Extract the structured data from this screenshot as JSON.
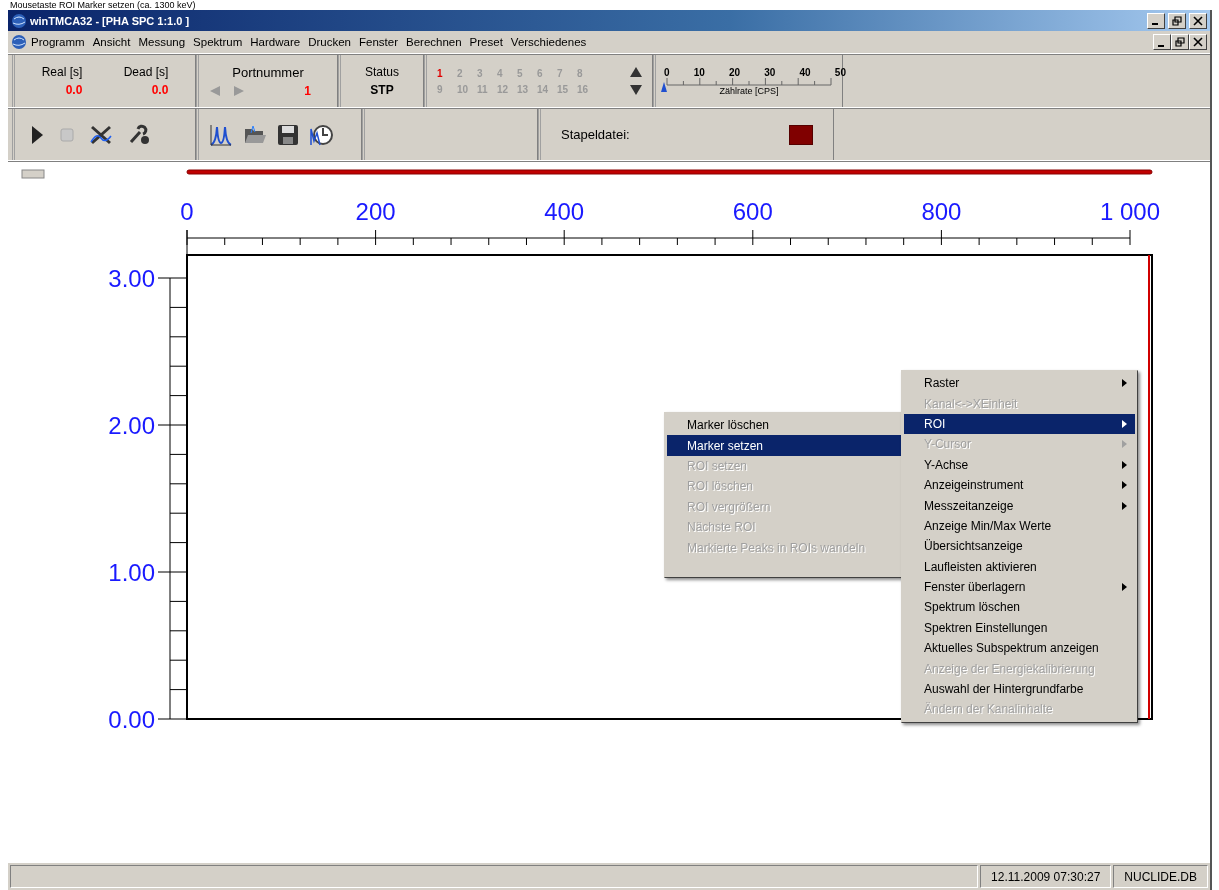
{
  "caption": "Mousetaste ROI Marker setzen (ca. 1300 keV)",
  "window": {
    "title": "winTMCA32 - [PHA SPC 1:1.0  ]"
  },
  "menu_bar": [
    "Programm",
    "Ansicht",
    "Messung",
    "Spektrum",
    "Hardware",
    "Drucken",
    "Fenster",
    "Berechnen",
    "Preset",
    "Verschiedenes"
  ],
  "times": [
    {
      "label": "Real [s]",
      "value": "0.0"
    },
    {
      "label": "Dead [s]",
      "value": "0.0"
    }
  ],
  "port": {
    "label": "Portnummer",
    "value": "1"
  },
  "status": {
    "label": "Status",
    "value": "STP"
  },
  "channels": [
    {
      "label": "1",
      "selected": true
    },
    {
      "label": "2",
      "selected": false
    },
    {
      "label": "3",
      "selected": false
    },
    {
      "label": "4",
      "selected": false
    },
    {
      "label": "5",
      "selected": false
    },
    {
      "label": "6",
      "selected": false
    },
    {
      "label": "7",
      "selected": false
    },
    {
      "label": "8",
      "selected": false
    },
    {
      "label": "9",
      "selected": false
    },
    {
      "label": "10",
      "selected": false
    },
    {
      "label": "11",
      "selected": false
    },
    {
      "label": "12",
      "selected": false
    },
    {
      "label": "13",
      "selected": false
    },
    {
      "label": "14",
      "selected": false
    },
    {
      "label": "15",
      "selected": false
    },
    {
      "label": "16",
      "selected": false
    }
  ],
  "rate_meter": {
    "ticks": [
      "0",
      "10",
      "20",
      "30",
      "40",
      "50"
    ],
    "label": "Zählrate [CPS]"
  },
  "batch": {
    "label": "Stapeldatei:"
  },
  "chart_data": {
    "type": "line",
    "xlim": [
      0,
      1000
    ],
    "ylim": [
      0,
      3
    ],
    "xticks": [
      0,
      200,
      400,
      600,
      800,
      {
        "value": 1000,
        "label": "1 000"
      }
    ],
    "yticks": [
      {
        "value": 0,
        "label": "0.00"
      },
      {
        "value": 1,
        "label": "1.00"
      },
      {
        "value": 2,
        "label": "2.00"
      },
      {
        "value": 3,
        "label": "3.00"
      }
    ]
  },
  "context_menu": [
    {
      "label": "Raster",
      "disabled": false,
      "selected": false,
      "submenu": true
    },
    {
      "label": "Kanal<->XEinheit",
      "disabled": true,
      "selected": false,
      "submenu": false
    },
    {
      "label": "ROI",
      "disabled": false,
      "selected": true,
      "submenu": true
    },
    {
      "label": "Y-Cursor",
      "disabled": true,
      "selected": false,
      "submenu": true
    },
    {
      "label": "Y-Achse",
      "disabled": false,
      "selected": false,
      "submenu": true
    },
    {
      "label": "Anzeigeinstrument",
      "disabled": false,
      "selected": false,
      "submenu": true
    },
    {
      "label": "Messzeitanzeige",
      "disabled": false,
      "selected": false,
      "submenu": true
    },
    {
      "label": "Anzeige Min/Max Werte",
      "disabled": false,
      "selected": false,
      "submenu": false
    },
    {
      "label": "Übersichtsanzeige",
      "disabled": false,
      "selected": false,
      "submenu": false
    },
    {
      "label": "Laufleisten aktivieren",
      "disabled": false,
      "selected": false,
      "submenu": false
    },
    {
      "label": "Fenster überlagern",
      "disabled": false,
      "selected": false,
      "submenu": true
    },
    {
      "label": "Spektrum löschen",
      "disabled": false,
      "selected": false,
      "submenu": false
    },
    {
      "label": "Spektren Einstellungen",
      "disabled": false,
      "selected": false,
      "submenu": false
    },
    {
      "label": "Aktuelles Subspektrum anzeigen",
      "disabled": false,
      "selected": false,
      "submenu": false
    },
    {
      "label": "Anzeige der Energiekalibrierung",
      "disabled": true,
      "selected": false,
      "submenu": false
    },
    {
      "label": "Auswahl der Hintergrundfarbe",
      "disabled": false,
      "selected": false,
      "submenu": false
    },
    {
      "label": "Ändern der Kanalinhalte",
      "disabled": true,
      "selected": false,
      "submenu": false
    }
  ],
  "submenu": [
    {
      "label": "Marker löschen",
      "disabled": false,
      "selected": false
    },
    {
      "label": "Marker setzen",
      "disabled": false,
      "selected": true
    },
    {
      "label": "ROI setzen",
      "disabled": true,
      "selected": false
    },
    {
      "label": "ROI löschen",
      "disabled": true,
      "selected": false
    },
    {
      "label": "ROI vergrößern",
      "disabled": true,
      "selected": false
    },
    {
      "label": "Nächste ROI",
      "disabled": true,
      "selected": false
    },
    {
      "label": "Markierte Peaks in ROIs wandeln",
      "disabled": true,
      "selected": false
    }
  ],
  "status_bar": [
    "12.11.2009 07:30:27",
    "NUCLIDE.DB"
  ]
}
